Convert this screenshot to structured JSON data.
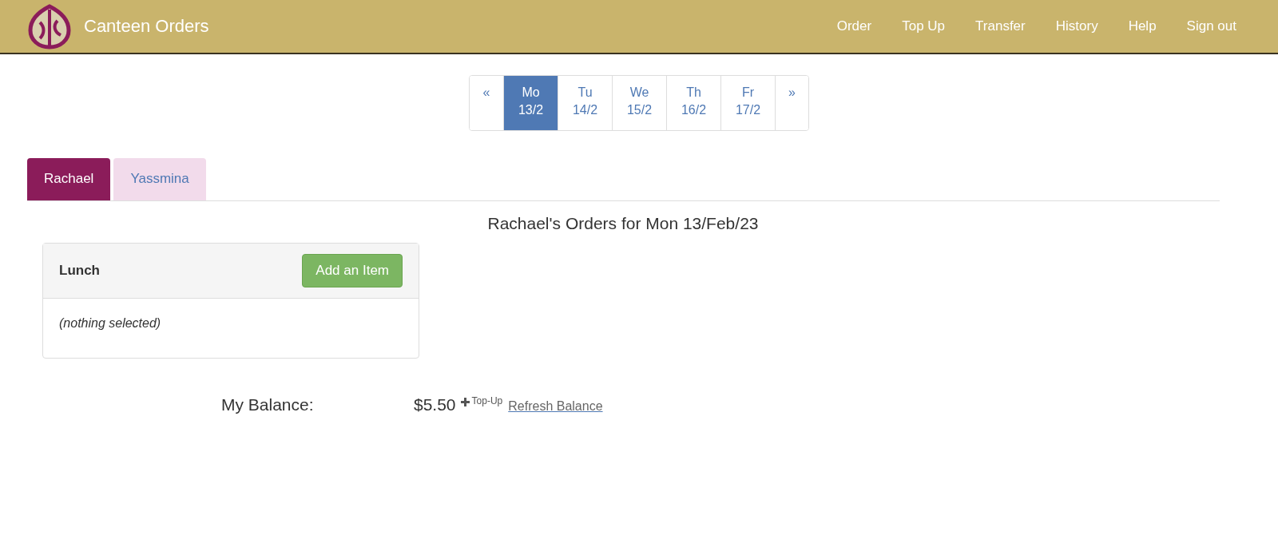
{
  "navbar": {
    "brand": "Canteen Orders",
    "links": [
      "Order",
      "Top Up",
      "Transfer",
      "History",
      "Help",
      "Sign out"
    ]
  },
  "day_pager": {
    "prev": "«",
    "next": "»",
    "days": [
      {
        "day": "Mo",
        "date": "13/2",
        "selected": true
      },
      {
        "day": "Tu",
        "date": "14/2",
        "selected": false
      },
      {
        "day": "We",
        "date": "15/2",
        "selected": false
      },
      {
        "day": "Th",
        "date": "16/2",
        "selected": false
      },
      {
        "day": "Fr",
        "date": "17/2",
        "selected": false
      }
    ]
  },
  "tabs": [
    {
      "label": "Rachael",
      "selected": true
    },
    {
      "label": "Yassmina",
      "selected": false
    }
  ],
  "heading": "Rachael's Orders for Mon 13/Feb/23",
  "panels": [
    {
      "title": "Lunch",
      "button": "Add an Item",
      "body": "(nothing selected)"
    }
  ],
  "balance": {
    "label": "My Balance:",
    "amount": "$5.50",
    "top_up": "Top-Up",
    "refresh": "Refresh Balance"
  }
}
